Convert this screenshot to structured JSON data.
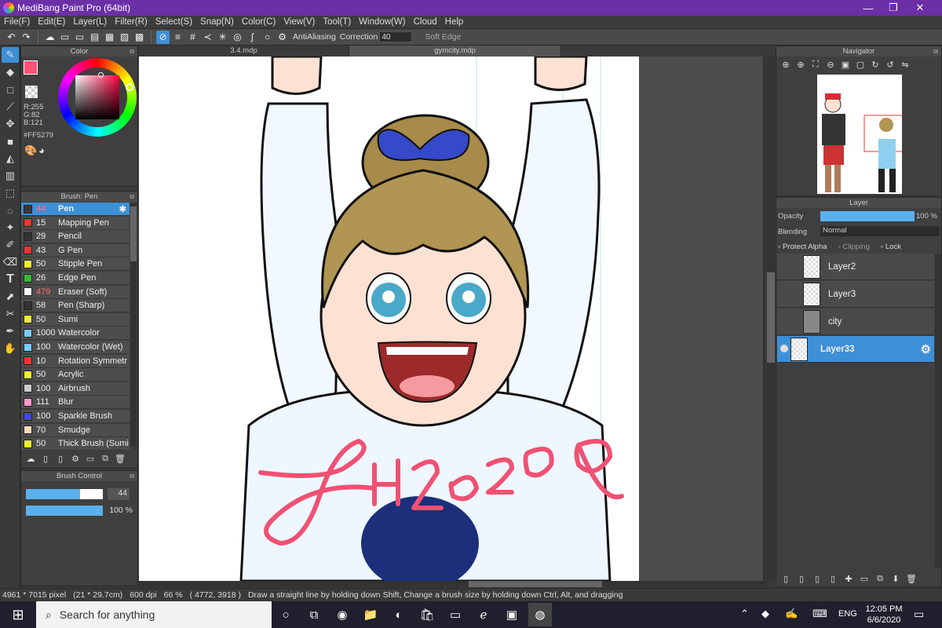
{
  "app": {
    "title": "MediBang Paint Pro (64bit)"
  },
  "window_controls": {
    "minimize": "—",
    "maximize": "❐",
    "close": "✕"
  },
  "menu": [
    "File(F)",
    "Edit(E)",
    "Layer(L)",
    "Filter(R)",
    "Select(S)",
    "Snap(N)",
    "Color(C)",
    "View(V)",
    "Tool(T)",
    "Window(W)",
    "Cloud",
    "Help"
  ],
  "toolbar": {
    "antialiasing": "AntiAliasing",
    "correction_label": "Correction",
    "correction_value": "40",
    "soft_edge": "Soft Edge"
  },
  "tabs": [
    "3.4.mdp",
    "gymcity.mdp"
  ],
  "color_panel": {
    "title": "Color",
    "r": "R:255",
    "g": "G:82",
    "b": "B:121",
    "hex": "#FF5279",
    "primary_color": "#FF5279"
  },
  "brush_panel": {
    "title": "Brush: Pen",
    "items": [
      {
        "size": "44",
        "name": "Pen",
        "color": "#3a3a3a",
        "active": true,
        "size_red": true
      },
      {
        "size": "15",
        "name": "Mapping Pen",
        "color": "#e33"
      },
      {
        "size": "29",
        "name": "Pencil",
        "color": "#333"
      },
      {
        "size": "43",
        "name": "G Pen",
        "color": "#e33"
      },
      {
        "size": "50",
        "name": "Stipple Pen",
        "color": "#ee3"
      },
      {
        "size": "26",
        "name": "Edge Pen",
        "color": "#3b3"
      },
      {
        "size": "479",
        "name": "Eraser (Soft)",
        "color": "#fff",
        "size_red": true
      },
      {
        "size": "58",
        "name": "Pen (Sharp)",
        "color": "#333"
      },
      {
        "size": "50",
        "name": "Sumi",
        "color": "#ee3"
      },
      {
        "size": "1000",
        "name": "Watercolor",
        "color": "#7cf"
      },
      {
        "size": "100",
        "name": "Watercolor (Wet)",
        "color": "#7cf"
      },
      {
        "size": "10",
        "name": "Rotation Symmetr",
        "color": "#e33"
      },
      {
        "size": "50",
        "name": "Acrylic",
        "color": "#ee3"
      },
      {
        "size": "100",
        "name": "Airbrush",
        "color": "#ccc"
      },
      {
        "size": "111",
        "name": "Blur",
        "color": "#f9c"
      },
      {
        "size": "100",
        "name": "Sparkle Brush",
        "color": "#44f"
      },
      {
        "size": "70",
        "name": "Smudge",
        "color": "#fdb"
      },
      {
        "size": "50",
        "name": "Thick Brush (Sumi",
        "color": "#ee3"
      }
    ]
  },
  "brush_control": {
    "title": "Brush Control",
    "size": "44",
    "opacity": "100 %",
    "size_fraction": 0.7,
    "opacity_fraction": 1.0
  },
  "navigator": {
    "title": "Navigator"
  },
  "layer_panel": {
    "title": "Layer",
    "opacity_label": "Opacity",
    "opacity_value": "100 %",
    "blending_label": "Blending",
    "blending_value": "Normal",
    "protect_alpha": "Protect Alpha",
    "clipping": "Clipping",
    "lock": "Lock",
    "layers": [
      {
        "name": "Layer2"
      },
      {
        "name": "Layer3"
      },
      {
        "name": "city"
      },
      {
        "name": "Layer33",
        "active": true
      }
    ]
  },
  "status": {
    "size_px": "4961 * 7015 pixel",
    "size_cm": "(21 * 29.7cm)",
    "dpi": "600 dpi",
    "zoom": "66 %",
    "coords": "( 4772, 3918 )",
    "hint": "Draw a straight line by holding down Shift, Change a brush size by holding down Ctrl, Alt, and dragging"
  },
  "taskbar": {
    "search_placeholder": "Search for anything",
    "lang": "ENG",
    "time": "12:05 PM",
    "date": "6/6/2020"
  },
  "artwork": {
    "signature": "LH2020"
  }
}
